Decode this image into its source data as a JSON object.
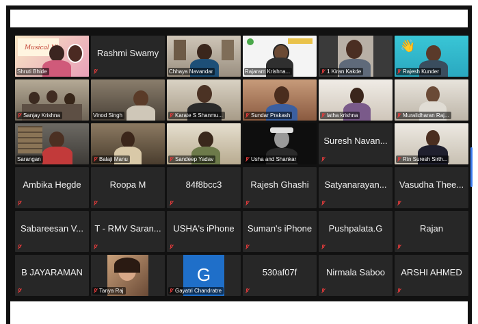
{
  "participants": [
    {
      "name": "Shruti Bhide",
      "video": true,
      "muted": false,
      "active": true,
      "banner": "Musical Ni"
    },
    {
      "name": "Rashmi Swamy",
      "video": false,
      "muted": true
    },
    {
      "name": "Chhaya Navandar",
      "video": true,
      "muted": false
    },
    {
      "name": "Rajaram Krishna...",
      "video": true,
      "muted": false
    },
    {
      "name": "1 Kiran Kakde",
      "video": true,
      "muted": true
    },
    {
      "name": "Rajesh Kunder",
      "video": true,
      "muted": true
    },
    {
      "name": "Sanjay Krishna",
      "video": true,
      "muted": true
    },
    {
      "name": "Vinod Singh",
      "video": true,
      "muted": false
    },
    {
      "name": "Karate S Shanmu...",
      "video": true,
      "muted": true
    },
    {
      "name": "Sundar Prakash",
      "video": true,
      "muted": true
    },
    {
      "name": "latha krishna",
      "video": true,
      "muted": true
    },
    {
      "name": "Muralidharan Raj...",
      "video": true,
      "muted": true
    },
    {
      "name": "Sarangan",
      "video": true,
      "muted": false
    },
    {
      "name": "Balaji Manu",
      "video": true,
      "muted": true
    },
    {
      "name": "Sandeep Yadav",
      "video": true,
      "muted": true
    },
    {
      "name": "Usha and Shankar",
      "video": true,
      "muted": true
    },
    {
      "name": "Suresh Navan...",
      "video": false,
      "muted": true
    },
    {
      "name": "Rtn Suresh Sirth...",
      "video": true,
      "muted": true
    },
    {
      "name": "Ambika Hegde",
      "video": false,
      "muted": true
    },
    {
      "name": "Roopa M",
      "video": false,
      "muted": true
    },
    {
      "name": "84f8bcc3",
      "video": false,
      "muted": true
    },
    {
      "name": "Rajesh Ghashi",
      "video": false,
      "muted": true
    },
    {
      "name": "Satyanarayan...",
      "video": false,
      "muted": true
    },
    {
      "name": "Vasudha Thee...",
      "video": false,
      "muted": true
    },
    {
      "name": "Sabareesan V...",
      "video": false,
      "muted": true
    },
    {
      "name": "T - RMV Saran...",
      "video": false,
      "muted": true
    },
    {
      "name": "USHA's iPhone",
      "video": false,
      "muted": true
    },
    {
      "name": "Suman's iPhone",
      "video": false,
      "muted": true
    },
    {
      "name": "Pushpalata.G",
      "video": false,
      "muted": true
    },
    {
      "name": "Rajan",
      "video": false,
      "muted": true
    },
    {
      "name": "B JAYARAMAN",
      "video": false,
      "muted": true
    },
    {
      "name": "Tanya Raj",
      "video": true,
      "muted": true
    },
    {
      "name": "Gayatri Chandratre",
      "video": true,
      "muted": true,
      "avatar_letter": "G"
    },
    {
      "name": "530af07f",
      "video": false,
      "muted": true
    },
    {
      "name": "Nirmala Saboo",
      "video": false,
      "muted": true
    },
    {
      "name": "ARSHI AHMED",
      "video": false,
      "muted": true
    }
  ],
  "colors": {
    "active_border": "#e8d44a",
    "muted_icon": "#e23b3b",
    "tile_bg": "#272727",
    "avatar_bg": "#1f6fc9"
  }
}
